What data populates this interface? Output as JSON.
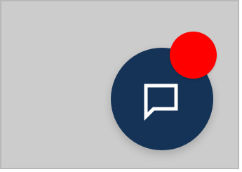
{
  "chat_widget": {
    "button_icon": "chat-bubble-icon",
    "button_color": "#143356",
    "badge_color": "#ff0000",
    "badge_count": "",
    "background_color": "#cccccc"
  }
}
